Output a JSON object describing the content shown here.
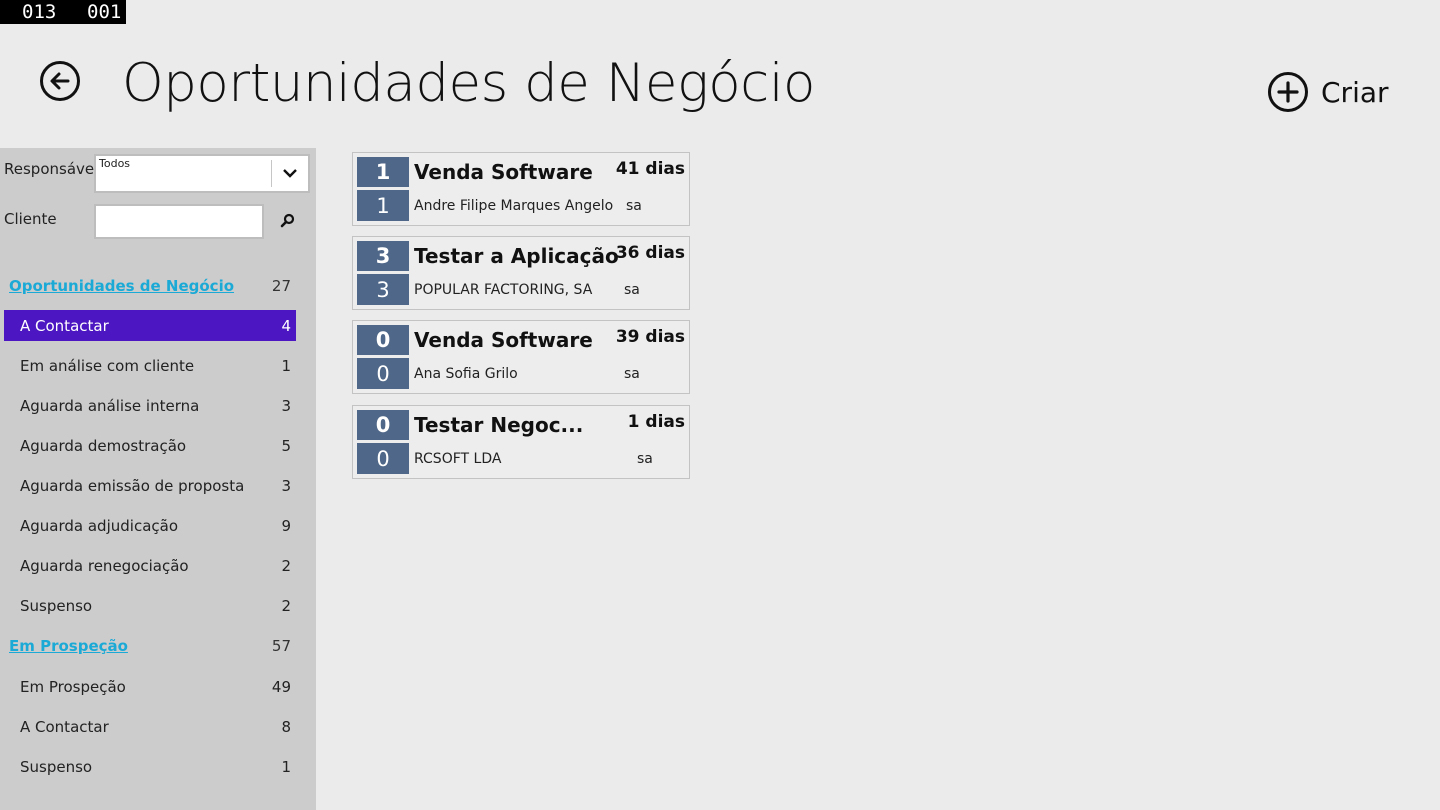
{
  "counter": {
    "left": "013",
    "right": "001"
  },
  "header": {
    "title": "Oportunidades de Negócio",
    "create_label": "Criar",
    "back_icon": "arrow-left-icon",
    "create_icon": "plus-circle-icon"
  },
  "filters": {
    "responsavel_label": "Responsável",
    "responsavel_value": "Todos",
    "cliente_label": "Cliente",
    "cliente_value": ""
  },
  "sidebar": {
    "groups": [
      {
        "title": "Oportunidades de Negócio",
        "count": "27",
        "items": [
          {
            "label": "A Contactar",
            "count": "4",
            "selected": true
          },
          {
            "label": "Em análise com cliente",
            "count": "1"
          },
          {
            "label": "Aguarda análise interna",
            "count": "3"
          },
          {
            "label": "Aguarda demostração",
            "count": "5"
          },
          {
            "label": "Aguarda emissão de proposta",
            "count": "3"
          },
          {
            "label": "Aguarda adjudicação",
            "count": "9"
          },
          {
            "label": "Aguarda renegociação",
            "count": "2"
          },
          {
            "label": "Suspenso",
            "count": "2"
          }
        ]
      },
      {
        "title": "Em Prospeção",
        "count": "57",
        "items": [
          {
            "label": "Em Prospeção",
            "count": "49"
          },
          {
            "label": "A Contactar",
            "count": "8"
          },
          {
            "label": "Suspenso",
            "count": "1"
          }
        ]
      }
    ]
  },
  "cards": [
    {
      "top": "1",
      "bottom": "1",
      "title": "Venda Software",
      "days": "41 dias",
      "client": "Andre Filipe Marques Angelo",
      "user": "sa"
    },
    {
      "top": "3",
      "bottom": "3",
      "title": "Testar a Aplicação",
      "days": "36 dias",
      "client": "POPULAR FACTORING, SA",
      "user": "sa"
    },
    {
      "top": "0",
      "bottom": "0",
      "title": "Venda Software",
      "days": "39 dias",
      "client": "Ana Sofia Grilo",
      "user": "sa"
    },
    {
      "top": "0",
      "bottom": "0",
      "title": "Testar Negoc...",
      "days": "1 dias",
      "client": "RCSOFT LDA",
      "user": "sa"
    }
  ],
  "colors": {
    "background": "#ebebeb",
    "sidebar": "#cccccc",
    "selected": "#4c17c2",
    "link": "#1ba9d6",
    "badge": "#4f6788"
  }
}
